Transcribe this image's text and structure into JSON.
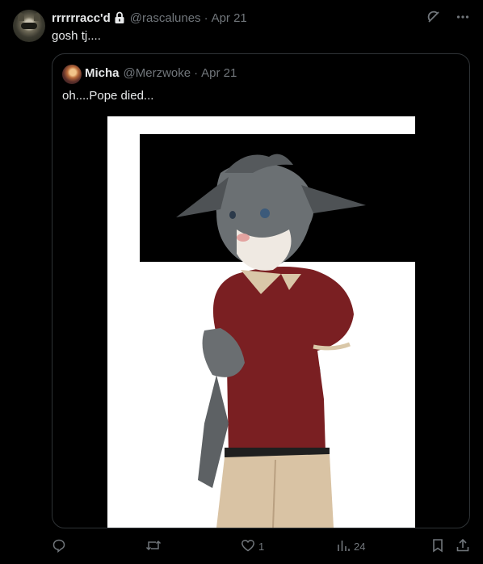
{
  "tweet": {
    "display_name": "rrrrrracc'd",
    "handle": "@rascalunes",
    "separator": "·",
    "date": "Apr 21",
    "text": "gosh tj....",
    "icons": [
      "lock-icon",
      "grok-icon",
      "more-icon"
    ]
  },
  "quoted": {
    "display_name": "Micha",
    "handle": "@Merzwoke",
    "separator": "·",
    "date": "Apr 21",
    "text": "oh....Pope died...",
    "image_alt": "Drawing of a grey lynx character in a red polo shirt and khaki pants"
  },
  "actions": {
    "reply_count": "",
    "repost_count": "",
    "like_count": "1",
    "views_count": "24",
    "icons": [
      "reply-icon",
      "repost-icon",
      "like-icon",
      "views-icon",
      "bookmark-icon",
      "share-icon"
    ]
  },
  "colors": {
    "background": "#000000",
    "text": "#e7e9ea",
    "secondary": "#71767b",
    "border": "#2f3336"
  }
}
